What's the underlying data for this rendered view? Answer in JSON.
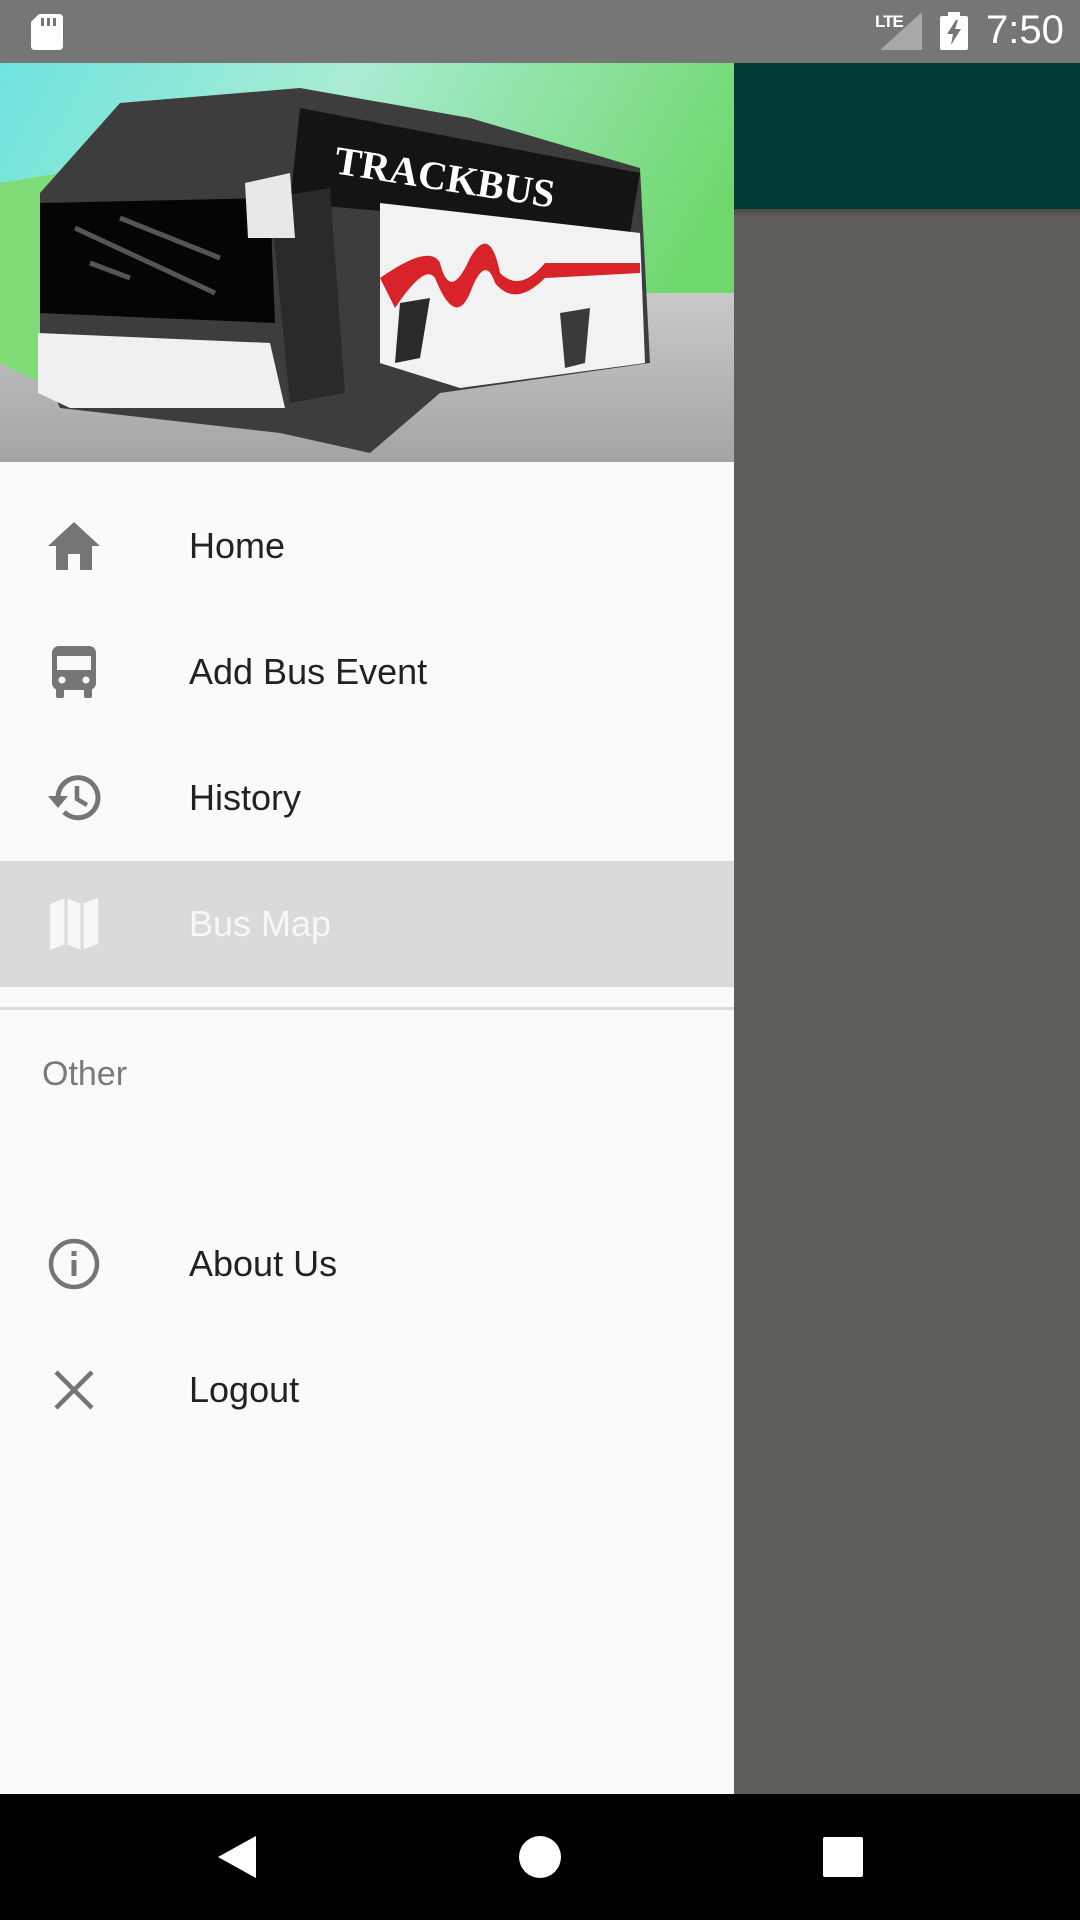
{
  "status_bar": {
    "time": "7:50",
    "network_type": "LTE",
    "icons": [
      "sd-card-icon",
      "signal-icon",
      "battery-charging-icon"
    ]
  },
  "drawer": {
    "header": {
      "image": "trackbus-bus-illustration",
      "logo_text": "TRACKBUS"
    },
    "items": [
      {
        "label": "Home",
        "icon": "home-icon"
      },
      {
        "label": "Add Bus Event",
        "icon": "bus-icon"
      },
      {
        "label": "History",
        "icon": "history-icon"
      },
      {
        "label": "Bus Map",
        "icon": "map-icon",
        "selected": true
      }
    ],
    "section": {
      "title": "Other",
      "items": [
        {
          "label": "About Us",
          "icon": "info-icon"
        },
        {
          "label": "Logout",
          "icon": "close-icon"
        }
      ]
    }
  },
  "nav_bar": {
    "buttons": [
      "back-icon",
      "home-circle-icon",
      "recents-icon"
    ]
  },
  "colors": {
    "status_bar": "#767676",
    "app_bar": "#003a35",
    "scrim": "#5f5e5b",
    "drawer_bg": "#fafafa",
    "selected_item_bg": "#dadada",
    "icon_gray": "#757575",
    "nav_bar": "#000000"
  }
}
